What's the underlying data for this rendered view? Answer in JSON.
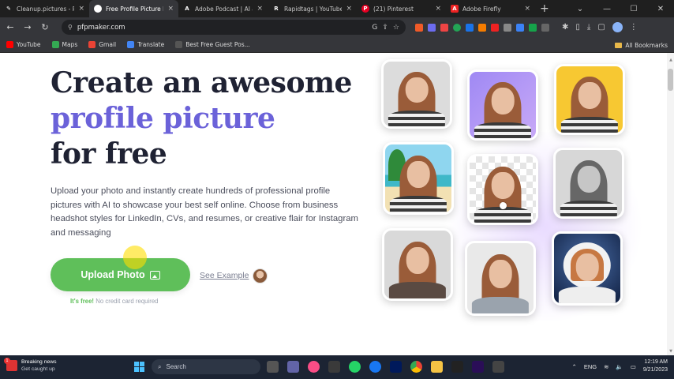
{
  "browser": {
    "tabs": [
      {
        "title": "Cleanup.pictures - Re",
        "icon": "cleanup-icon",
        "active": false
      },
      {
        "title": "Free Profile Picture M",
        "icon": "pfpmaker-icon",
        "active": true
      },
      {
        "title": "Adobe Podcast | AI au",
        "icon": "adobe-podcast-icon",
        "active": false
      },
      {
        "title": "Rapidtags | YouTube T",
        "icon": "rapidtags-icon",
        "active": false
      },
      {
        "title": "(21) Pinterest",
        "icon": "pinterest-icon",
        "active": false
      },
      {
        "title": "Adobe Firefly",
        "icon": "adobe-firefly-icon",
        "active": false
      }
    ],
    "url": "pfpmaker.com",
    "bookmarks": [
      "YouTube",
      "Maps",
      "Gmail",
      "Translate",
      "Best Free Guest Pos..."
    ],
    "all_bookmarks": "All Bookmarks"
  },
  "hero": {
    "line1": "Create an awesome",
    "line2": "profile picture",
    "line3": "for free",
    "description": "Upload your photo and instantly create hundreds of professional profile pictures with AI to showcase your best self online. Choose from business headshot styles for LinkedIn, CVs, and resumes, or creative flair for Instagram and messaging",
    "upload_label": "Upload Photo",
    "see_example": "See Example",
    "free_strong": "It's free!",
    "free_note": " No credit card required"
  },
  "taskbar": {
    "news_title": "Breaking news",
    "news_sub": "Get caught up",
    "news_badge": "1",
    "search": "Search",
    "lang": "ENG",
    "time": "12:19 AM",
    "date": "9/21/2023"
  },
  "colors": {
    "accent": "#6b62d9",
    "button": "#5fbf5a",
    "headline": "#1f2233"
  }
}
